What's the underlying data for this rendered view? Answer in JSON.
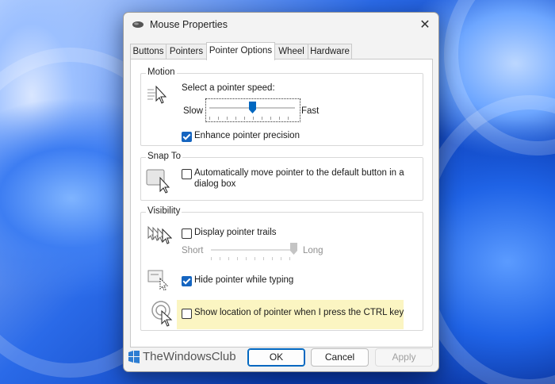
{
  "window": {
    "title": "Mouse Properties",
    "close_glyph": "✕"
  },
  "tabs": [
    {
      "label": "Buttons",
      "active": false
    },
    {
      "label": "Pointers",
      "active": false
    },
    {
      "label": "Pointer Options",
      "active": true
    },
    {
      "label": "Wheel",
      "active": false
    },
    {
      "label": "Hardware",
      "active": false
    }
  ],
  "motion": {
    "title": "Motion",
    "speed_label": "Select a pointer speed:",
    "slow_label": "Slow",
    "fast_label": "Fast",
    "speed_value": 0.5,
    "enhance_label": "Enhance pointer precision",
    "enhance_checked": true
  },
  "snap": {
    "title": "Snap To",
    "label_line1": "Automatically move pointer to the default button in a",
    "label_line2": "dialog box",
    "checked": false
  },
  "visibility": {
    "title": "Visibility",
    "trails_label": "Display pointer trails",
    "trails_checked": false,
    "short_label": "Short",
    "long_label": "Long",
    "trail_length_value": 1.0,
    "hide_label": "Hide pointer while typing",
    "hide_checked": true,
    "ctrl_label": "Show location of pointer when I press the CTRL key",
    "ctrl_checked": false
  },
  "buttons": {
    "ok": "OK",
    "cancel": "Cancel",
    "apply": "Apply"
  },
  "watermark": {
    "text": "TheWindowsClub"
  },
  "colors": {
    "accent": "#0067c0",
    "checkbox_checked": "#1565c0",
    "highlight": "#fbf5c2"
  },
  "icons": [
    "mouse-icon",
    "close-icon",
    "pointer-speed-icon",
    "snap-to-icon",
    "pointer-trails-icon",
    "hide-pointer-icon",
    "ctrl-locate-icon",
    "slider-thumb-icon",
    "windowsclub-logo-icon"
  ]
}
